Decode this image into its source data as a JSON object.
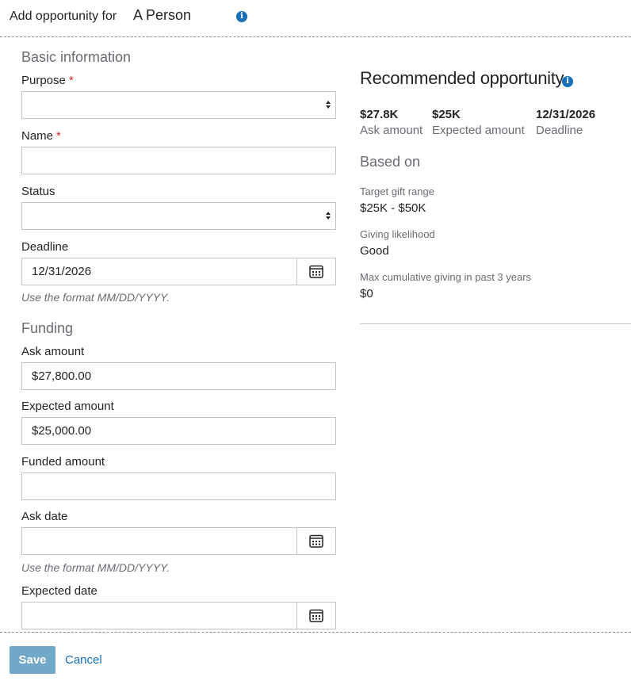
{
  "header": {
    "title_prefix": "Add opportunity for",
    "title_name": "A Person",
    "info_icon": "info-icon"
  },
  "basic": {
    "section_title": "Basic information",
    "purpose": {
      "label": "Purpose",
      "required_mark": "*",
      "value": ""
    },
    "name": {
      "label": "Name",
      "required_mark": "*",
      "value": ""
    },
    "status": {
      "label": "Status",
      "value": ""
    },
    "deadline": {
      "label": "Deadline",
      "value": "12/31/2026",
      "hint": "Use the format MM/DD/YYYY."
    }
  },
  "funding": {
    "section_title": "Funding",
    "ask_amount": {
      "label": "Ask amount",
      "value": "$27,800.00"
    },
    "expected_amount": {
      "label": "Expected amount",
      "value": "$25,000.00"
    },
    "funded_amount": {
      "label": "Funded amount",
      "value": ""
    },
    "ask_date": {
      "label": "Ask date",
      "value": "",
      "hint": "Use the format MM/DD/YYYY."
    },
    "expected_date": {
      "label": "Expected date",
      "value": ""
    }
  },
  "recommended": {
    "title": "Recommended opportunity",
    "stats": [
      {
        "value": "$27.8K",
        "label": "Ask amount"
      },
      {
        "value": "$25K",
        "label": "Expected amount"
      },
      {
        "value": "12/31/2026",
        "label": "Deadline"
      }
    ],
    "based_on_title": "Based on",
    "basis": [
      {
        "label": "Target gift range",
        "value": "$25K - $50K"
      },
      {
        "label": "Giving likelihood",
        "value": "Good"
      },
      {
        "label": "Max cumulative giving in past 3 years",
        "value": "$0"
      }
    ]
  },
  "footer": {
    "save_label": "Save",
    "cancel_label": "Cancel"
  },
  "colors": {
    "accent": "#1870b8",
    "save_button": "#71a8c9",
    "required": "#c82e2e"
  }
}
